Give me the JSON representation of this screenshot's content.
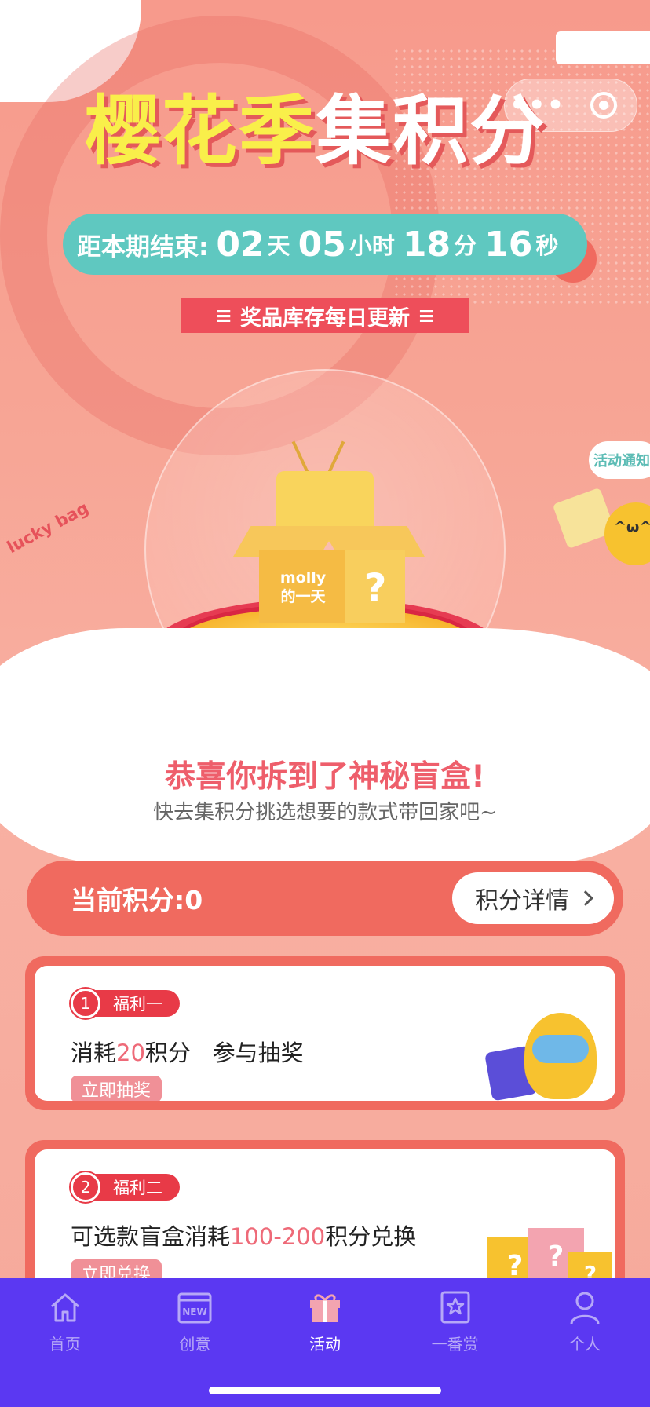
{
  "header": {
    "title_part1": "樱花季",
    "title_part2": "集积分",
    "capsule_more": "•••"
  },
  "countdown": {
    "label": "距本期结束:",
    "days": "02",
    "days_unit": "天",
    "hours": "05",
    "hours_unit": "小时",
    "minutes": "18",
    "minutes_unit": "分",
    "seconds": "16",
    "seconds_unit": "秒"
  },
  "banner": {
    "text": "奖品库存每日更新"
  },
  "hero": {
    "box_label": "molly\n的一天",
    "box_mark": "?",
    "lucky_bag": "lucky bag",
    "notice": "活动通知",
    "mascot_face": "^ω^"
  },
  "congrats": {
    "title": "恭喜你拆到了神秘盲盒!",
    "subtitle": "快去集积分挑选想要的款式带回家吧~"
  },
  "points": {
    "current": "当前积分:0",
    "detail_button": "积分详情"
  },
  "welfare": [
    {
      "num": "1",
      "tag": "福利一",
      "desc_pre": "消耗",
      "desc_hl": "20",
      "desc_post": "积分   参与抽奖",
      "action": "立即抽奖"
    },
    {
      "num": "2",
      "tag": "福利二",
      "desc_pre": "可选款盲盒消耗",
      "desc_hl": "100-200",
      "desc_post": "积分兑换",
      "action": "立即兑换"
    }
  ],
  "tabbar": {
    "items": [
      {
        "label": "首页",
        "icon": "home-icon"
      },
      {
        "label": "创意",
        "icon": "new-icon"
      },
      {
        "label": "活动",
        "icon": "gift-icon",
        "active": true
      },
      {
        "label": "一番赏",
        "icon": "bookmark-star-icon"
      },
      {
        "label": "个人",
        "icon": "person-icon"
      }
    ]
  },
  "colors": {
    "accent": "#f06a5f",
    "tabbar": "#5b38f2",
    "countdown": "#5fc8c0",
    "highlight": "#ee6a78"
  }
}
